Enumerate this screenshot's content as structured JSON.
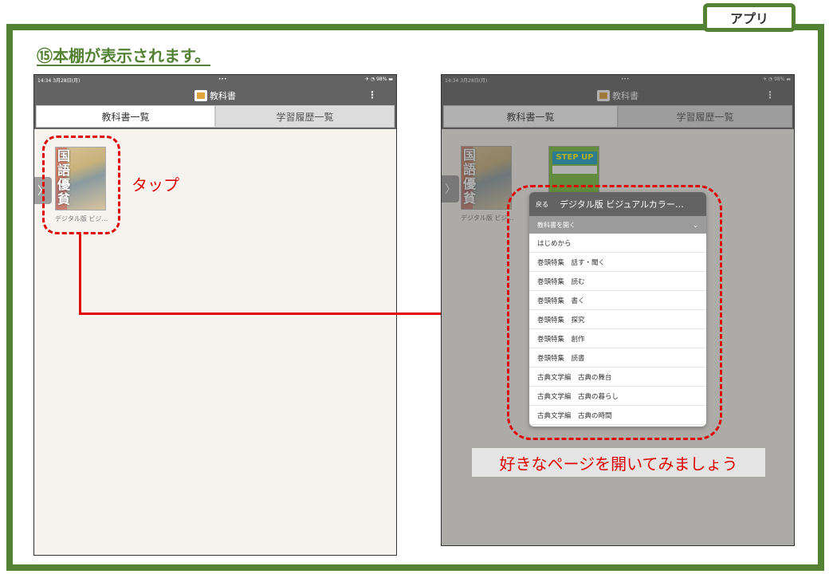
{
  "header": {
    "app_label": "アプリ",
    "heading": "⑮本棚が表示されます。"
  },
  "tablet_left": {
    "status_time": "14:34  3月28日(月)",
    "status_dots": "•••",
    "status_battery": "✈ ◔ 98% ▬",
    "app_title": "教科書",
    "menu_icon": "⋮",
    "tabs": [
      "教科書一覧",
      "学習履歴一覧"
    ],
    "book_kanji": "国\n語\n優\n貧",
    "book_title": "デジタル版 ビジ…",
    "handle": "〉"
  },
  "annotations": {
    "tap": "タップ",
    "note": "好きなページを開いてみましょう"
  },
  "tablet_right": {
    "status_time": "14:34  3月28日(月)",
    "status_dots": "•••",
    "status_battery": "✈ ◔ 98% ▬",
    "app_title": "教科書",
    "menu_icon": "⋮",
    "tabs": [
      "教科書一覧",
      "学習履歴一覧"
    ],
    "book_title": "デジタル版 ビジ…",
    "book2_band": "STEP UP",
    "handle": "〉",
    "popup": {
      "back": "戻る",
      "title": "デジタル版 ビジュアルカラー…",
      "subheader": "教科書を開く",
      "chevron": "⌄",
      "items": [
        "はじめから",
        "巻頭特集　話す・聞く",
        "巻頭特集　読む",
        "巻頭特集　書く",
        "巻頭特集　探究",
        "巻頭特集　創作",
        "巻頭特集　読書",
        "古典文学編　古典の舞台",
        "古典文学編　古典の暮らし",
        "古典文学編　古典の時間"
      ]
    }
  },
  "colors": {
    "frame_green": "#548235",
    "annotation_red": "#e00000",
    "navbar_gray": "#636363"
  }
}
